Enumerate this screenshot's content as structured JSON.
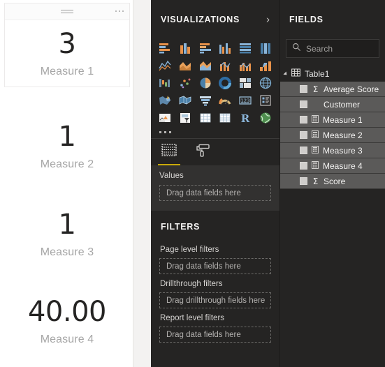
{
  "canvas": {
    "cards": [
      {
        "value": "3",
        "label": "Measure 1",
        "framed": true,
        "menu_icon": "ellipsis-icon",
        "handle_icon": "drag-handle-icon"
      },
      {
        "value": "1",
        "label": "Measure 2",
        "framed": false
      },
      {
        "value": "1",
        "label": "Measure 3",
        "framed": false
      },
      {
        "value": "40.00",
        "label": "Measure 4",
        "framed": false
      }
    ]
  },
  "visualizations": {
    "title": "VISUALIZATIONS",
    "collapse_icon": "chevron-right-icon",
    "more_icon": "ellipsis-icon",
    "gallery": [
      "stacked-bar-chart-icon",
      "stacked-column-chart-icon",
      "clustered-bar-chart-icon",
      "clustered-column-chart-icon",
      "hundred-percent-stacked-bar-chart-icon",
      "hundred-percent-stacked-column-chart-icon",
      "line-chart-icon",
      "area-chart-icon",
      "stacked-area-chart-icon",
      "line-stacked-column-chart-icon",
      "line-clustered-column-chart-icon",
      "ribbon-chart-icon",
      "waterfall-chart-icon",
      "scatter-chart-icon",
      "pie-chart-icon",
      "donut-chart-icon",
      "treemap-icon",
      "map-icon",
      "filled-map-icon",
      "shape-map-icon",
      "funnel-chart-icon",
      "gauge-chart-icon",
      "card-icon",
      "multi-row-card-icon",
      "kpi-icon",
      "slicer-icon",
      "table-icon",
      "matrix-icon",
      "r-script-visual-icon",
      "arcgis-map-icon"
    ],
    "tabs": [
      {
        "name": "fields-tab",
        "icon": "fields-grid-icon",
        "active": true
      },
      {
        "name": "format-tab",
        "icon": "paint-roller-icon",
        "active": false
      }
    ],
    "accent_color": "#c8a90a",
    "well": {
      "title": "Values",
      "dropzone_placeholder": "Drag data fields here"
    },
    "filters": {
      "title": "FILTERS",
      "groups": [
        {
          "label": "Page level filters",
          "placeholder": "Drag data fields here"
        },
        {
          "label": "Drillthrough filters",
          "placeholder": "Drag drillthrough fields here"
        },
        {
          "label": "Report level filters",
          "placeholder": "Drag data fields here"
        }
      ]
    }
  },
  "fields": {
    "title": "FIELDS",
    "search": {
      "placeholder": "Search",
      "icon": "search-icon",
      "value": ""
    },
    "table": {
      "name": "Table1",
      "icon": "table-icon",
      "expander_icon": "triangle-expanded-icon",
      "expanded": true
    },
    "items": [
      {
        "label": "Average Score",
        "type": "sigma",
        "checked": false
      },
      {
        "label": "Customer",
        "type": "plain",
        "checked": false
      },
      {
        "label": "Measure 1",
        "type": "measure",
        "checked": false
      },
      {
        "label": "Measure 2",
        "type": "measure",
        "checked": false
      },
      {
        "label": "Measure 3",
        "type": "measure",
        "checked": false
      },
      {
        "label": "Measure 4",
        "type": "measure",
        "checked": false
      },
      {
        "label": "Score",
        "type": "sigma",
        "checked": false
      }
    ]
  }
}
